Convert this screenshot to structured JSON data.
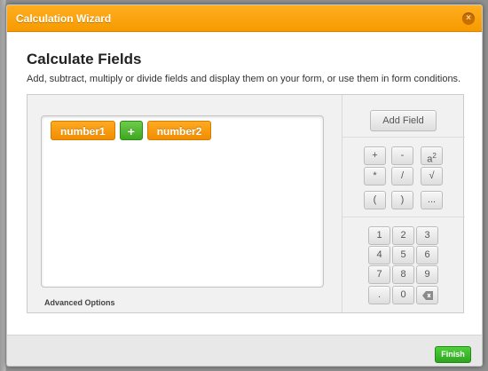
{
  "window": {
    "title": "Calculation Wizard",
    "close_glyph": "×"
  },
  "main": {
    "heading": "Calculate Fields",
    "description": "Add, subtract, multiply or divide fields and display them on your form, or use them in form conditions."
  },
  "formula": {
    "tokens": [
      {
        "type": "field",
        "label": "number1"
      },
      {
        "type": "operator",
        "label": "+"
      },
      {
        "type": "field",
        "label": "number2"
      }
    ],
    "advanced_options_label": "Advanced Options"
  },
  "toolbar": {
    "add_field_label": "Add Field"
  },
  "operators": {
    "plus": "+",
    "minus": "-",
    "power_base": "a",
    "power_exp": "2",
    "multiply": "*",
    "divide": "/",
    "sqrt": "√",
    "open_paren": "(",
    "close_paren": ")",
    "more": "..."
  },
  "keypad": {
    "k1": "1",
    "k2": "2",
    "k3": "3",
    "k4": "4",
    "k5": "5",
    "k6": "6",
    "k7": "7",
    "k8": "8",
    "k9": "9",
    "dot": ".",
    "k0": "0",
    "backspace_icon": "backspace-icon"
  },
  "footer": {
    "finish_label": "Finish"
  },
  "colors": {
    "title_bar": "#f79a00",
    "field_token": "#f28d00",
    "operator_token": "#3fa71f",
    "finish_button": "#2ea51f"
  }
}
